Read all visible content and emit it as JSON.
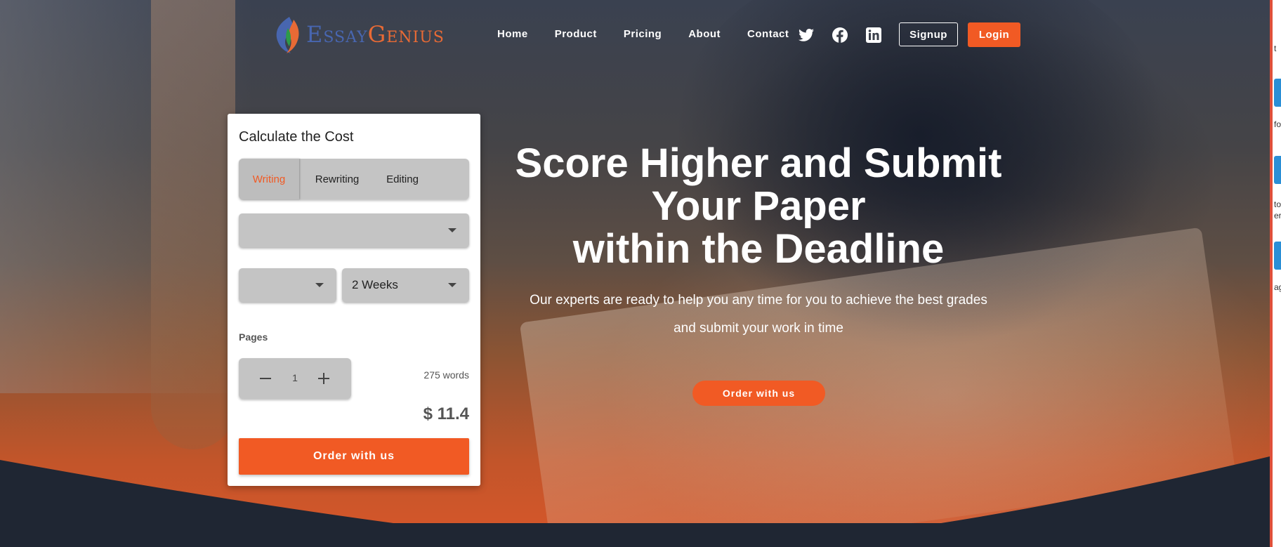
{
  "brand": {
    "logo_part1": "Essay",
    "logo_part2": "Genius",
    "color_blue": "#4866b0",
    "color_orange": "#e86a35"
  },
  "nav": {
    "items": [
      "Home",
      "Product",
      "Pricing",
      "About",
      "Contact"
    ],
    "social_icons": [
      "twitter-icon",
      "facebook-icon",
      "linkedin-icon"
    ],
    "signup_label": "Signup",
    "login_label": "Login"
  },
  "calculator": {
    "title": "Calculate the Cost",
    "tabs": [
      "Writing",
      "Rewriting",
      "Editing"
    ],
    "active_tab": "Writing",
    "select_main_value": "",
    "select_small_value": "",
    "deadline_value": "2 Weeks",
    "pages_label": "Pages",
    "pages_value": "1",
    "words_label": "275 words",
    "price": "$ 11.4",
    "order_label": "Order with us"
  },
  "hero": {
    "headline_line1": "Score Higher and Submit",
    "headline_line2": "Your Paper",
    "headline_line3": "within the Deadline",
    "subtext": "Our experts are ready to help you any time for you to achieve the best grades and submit your work in time",
    "order_label": "Order with us"
  },
  "side_panel": {
    "snippets": [
      "t",
      "fol",
      "to",
      "er.",
      "ag"
    ]
  },
  "colors": {
    "accent": "#f15a24",
    "card_bg": "#ffffff",
    "control_bg": "#c4c4c4",
    "footer_bg": "#1f2633"
  }
}
